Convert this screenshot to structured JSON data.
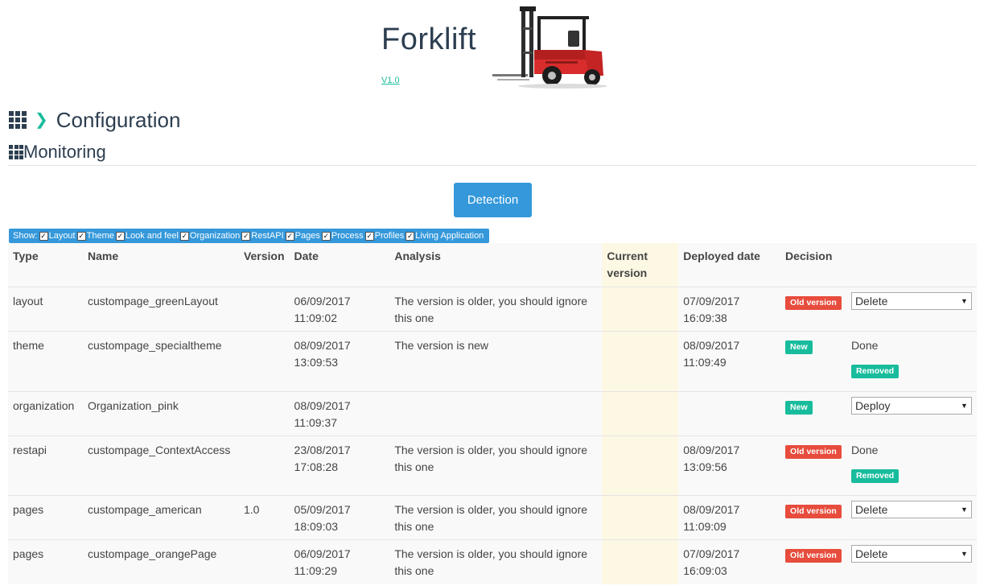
{
  "app": {
    "title": "Forklift",
    "version": "V1.0"
  },
  "breadcrumb": {
    "section": "Configuration",
    "page": "Monitoring"
  },
  "actions": {
    "detect_label": "Detection"
  },
  "filter": {
    "label": "Show:",
    "options": [
      "Layout",
      "Theme",
      "Look and feel",
      "Organization",
      "RestAPI",
      "Pages",
      "Process",
      "Profiles",
      "Living Application"
    ]
  },
  "table": {
    "headers": {
      "type": "Type",
      "name": "Name",
      "version": "Version",
      "date": "Date",
      "analysis": "Analysis",
      "current_version": "Current version",
      "deployed_date": "Deployed date",
      "decision": "Decision"
    },
    "rows": [
      {
        "type": "layout",
        "name": "custompage_greenLayout",
        "version": "",
        "date": "06/09/2017",
        "time": "11:09:02",
        "analysis": "The version is older, you should ignore this one",
        "current_version": "",
        "deployed_date": "07/09/2017",
        "deployed_time": "16:09:38",
        "badge": "Old version",
        "decision_select": "Delete",
        "decision_text": "",
        "status": ""
      },
      {
        "type": "theme",
        "name": "custompage_specialtheme",
        "version": "",
        "date": "08/09/2017",
        "time": "13:09:53",
        "analysis": "The version is new",
        "current_version": "",
        "deployed_date": "08/09/2017",
        "deployed_time": "11:09:49",
        "badge": "New",
        "decision_select": "",
        "decision_text": "Done",
        "status": "Removed"
      },
      {
        "type": "organization",
        "name": "Organization_pink",
        "version": "",
        "date": "08/09/2017",
        "time": "11:09:37",
        "analysis": "",
        "current_version": "",
        "deployed_date": "",
        "deployed_time": "",
        "badge": "New",
        "decision_select": "Deploy",
        "decision_text": "",
        "status": ""
      },
      {
        "type": "restapi",
        "name": "custompage_ContextAccess",
        "version": "",
        "date": "23/08/2017",
        "time": "17:08:28",
        "analysis": "The version is older, you should ignore this one",
        "current_version": "",
        "deployed_date": "08/09/2017",
        "deployed_time": "13:09:56",
        "badge": "Old version",
        "decision_select": "",
        "decision_text": "Done",
        "status": "Removed"
      },
      {
        "type": "pages",
        "name": "custompage_american",
        "version": "1.0",
        "date": "05/09/2017",
        "time": "18:09:03",
        "analysis": "The version is older, you should ignore this one",
        "current_version": "",
        "deployed_date": "08/09/2017",
        "deployed_time": "11:09:09",
        "badge": "Old version",
        "decision_select": "Delete",
        "decision_text": "",
        "status": ""
      },
      {
        "type": "pages",
        "name": "custompage_orangePage",
        "version": "",
        "date": "06/09/2017",
        "time": "11:09:29",
        "analysis": "The version is older, you should ignore this one",
        "current_version": "",
        "deployed_date": "07/09/2017",
        "deployed_time": "16:09:03",
        "badge": "Old version",
        "decision_select": "Delete",
        "decision_text": "",
        "status": ""
      }
    ]
  },
  "colors": {
    "primary": "#3498db",
    "accent": "#18bc9c",
    "danger": "#e74c3c",
    "heading": "#2c3e50",
    "highlight_column": "#fdf8e4"
  },
  "icons": {
    "apps": "grid-icon",
    "breadcrumb_separator": "chevron-right-icon",
    "logo": "forklift-logo"
  }
}
